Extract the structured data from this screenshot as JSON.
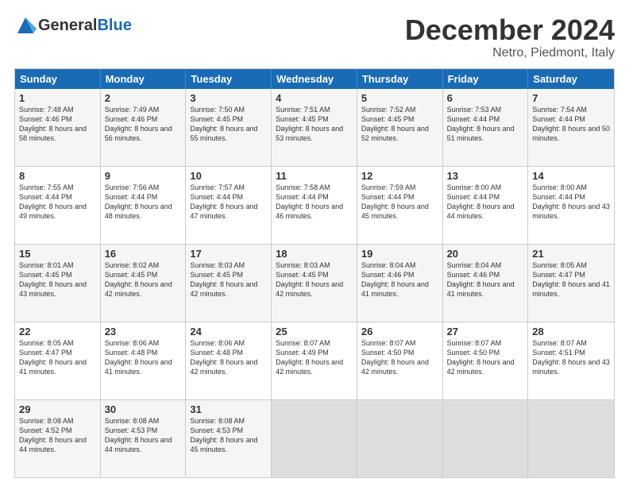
{
  "header": {
    "logo_general": "General",
    "logo_blue": "Blue",
    "month_title": "December 2024",
    "location": "Netro, Piedmont, Italy"
  },
  "days_of_week": [
    "Sunday",
    "Monday",
    "Tuesday",
    "Wednesday",
    "Thursday",
    "Friday",
    "Saturday"
  ],
  "weeks": [
    [
      {
        "day": "1",
        "sunrise": "7:48 AM",
        "sunset": "4:46 PM",
        "daylight": "8 hours and 58 minutes"
      },
      {
        "day": "2",
        "sunrise": "7:49 AM",
        "sunset": "4:46 PM",
        "daylight": "8 hours and 56 minutes"
      },
      {
        "day": "3",
        "sunrise": "7:50 AM",
        "sunset": "4:45 PM",
        "daylight": "8 hours and 55 minutes"
      },
      {
        "day": "4",
        "sunrise": "7:51 AM",
        "sunset": "4:45 PM",
        "daylight": "8 hours and 53 minutes"
      },
      {
        "day": "5",
        "sunrise": "7:52 AM",
        "sunset": "4:45 PM",
        "daylight": "8 hours and 52 minutes"
      },
      {
        "day": "6",
        "sunrise": "7:53 AM",
        "sunset": "4:44 PM",
        "daylight": "8 hours and 51 minutes"
      },
      {
        "day": "7",
        "sunrise": "7:54 AM",
        "sunset": "4:44 PM",
        "daylight": "8 hours and 50 minutes"
      }
    ],
    [
      {
        "day": "8",
        "sunrise": "7:55 AM",
        "sunset": "4:44 PM",
        "daylight": "8 hours and 49 minutes"
      },
      {
        "day": "9",
        "sunrise": "7:56 AM",
        "sunset": "4:44 PM",
        "daylight": "8 hours and 48 minutes"
      },
      {
        "day": "10",
        "sunrise": "7:57 AM",
        "sunset": "4:44 PM",
        "daylight": "8 hours and 47 minutes"
      },
      {
        "day": "11",
        "sunrise": "7:58 AM",
        "sunset": "4:44 PM",
        "daylight": "8 hours and 46 minutes"
      },
      {
        "day": "12",
        "sunrise": "7:59 AM",
        "sunset": "4:44 PM",
        "daylight": "8 hours and 45 minutes"
      },
      {
        "day": "13",
        "sunrise": "8:00 AM",
        "sunset": "4:44 PM",
        "daylight": "8 hours and 44 minutes"
      },
      {
        "day": "14",
        "sunrise": "8:00 AM",
        "sunset": "4:44 PM",
        "daylight": "8 hours and 43 minutes"
      }
    ],
    [
      {
        "day": "15",
        "sunrise": "8:01 AM",
        "sunset": "4:45 PM",
        "daylight": "8 hours and 43 minutes"
      },
      {
        "day": "16",
        "sunrise": "8:02 AM",
        "sunset": "4:45 PM",
        "daylight": "8 hours and 42 minutes"
      },
      {
        "day": "17",
        "sunrise": "8:03 AM",
        "sunset": "4:45 PM",
        "daylight": "8 hours and 42 minutes"
      },
      {
        "day": "18",
        "sunrise": "8:03 AM",
        "sunset": "4:45 PM",
        "daylight": "8 hours and 42 minutes"
      },
      {
        "day": "19",
        "sunrise": "8:04 AM",
        "sunset": "4:46 PM",
        "daylight": "8 hours and 41 minutes"
      },
      {
        "day": "20",
        "sunrise": "8:04 AM",
        "sunset": "4:46 PM",
        "daylight": "8 hours and 41 minutes"
      },
      {
        "day": "21",
        "sunrise": "8:05 AM",
        "sunset": "4:47 PM",
        "daylight": "8 hours and 41 minutes"
      }
    ],
    [
      {
        "day": "22",
        "sunrise": "8:05 AM",
        "sunset": "4:47 PM",
        "daylight": "8 hours and 41 minutes"
      },
      {
        "day": "23",
        "sunrise": "8:06 AM",
        "sunset": "4:48 PM",
        "daylight": "8 hours and 41 minutes"
      },
      {
        "day": "24",
        "sunrise": "8:06 AM",
        "sunset": "4:48 PM",
        "daylight": "8 hours and 42 minutes"
      },
      {
        "day": "25",
        "sunrise": "8:07 AM",
        "sunset": "4:49 PM",
        "daylight": "8 hours and 42 minutes"
      },
      {
        "day": "26",
        "sunrise": "8:07 AM",
        "sunset": "4:50 PM",
        "daylight": "8 hours and 42 minutes"
      },
      {
        "day": "27",
        "sunrise": "8:07 AM",
        "sunset": "4:50 PM",
        "daylight": "8 hours and 42 minutes"
      },
      {
        "day": "28",
        "sunrise": "8:07 AM",
        "sunset": "4:51 PM",
        "daylight": "8 hours and 43 minutes"
      }
    ],
    [
      {
        "day": "29",
        "sunrise": "8:08 AM",
        "sunset": "4:52 PM",
        "daylight": "8 hours and 44 minutes"
      },
      {
        "day": "30",
        "sunrise": "8:08 AM",
        "sunset": "4:53 PM",
        "daylight": "8 hours and 44 minutes"
      },
      {
        "day": "31",
        "sunrise": "8:08 AM",
        "sunset": "4:53 PM",
        "daylight": "8 hours and 45 minutes"
      },
      null,
      null,
      null,
      null
    ]
  ]
}
